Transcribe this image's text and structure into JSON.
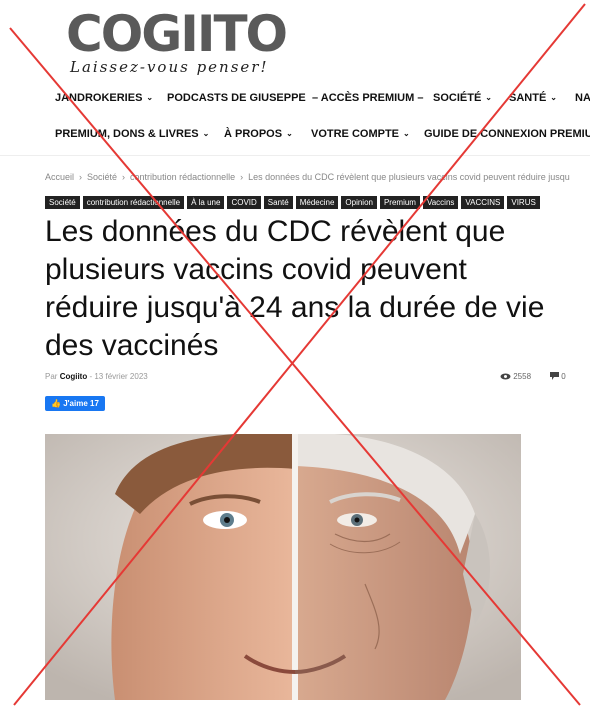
{
  "logo": {
    "text": "COGIITO",
    "tagline": "Laissez-vous penser!"
  },
  "nav": {
    "row1": [
      {
        "label": "JANDROKERIES",
        "chevron": true
      },
      {
        "label": "PODCASTS DE GIUSEPPE",
        "chevron": false
      },
      {
        "label": "– ACCÈS PREMIUM –",
        "chevron": false
      },
      {
        "label": "SOCIÉTÉ",
        "chevron": true
      },
      {
        "label": "SANTÉ",
        "chevron": true
      },
      {
        "label": "NA",
        "chevron": false
      }
    ],
    "row2": [
      {
        "label": "PREMIUM, DONS & LIVRES",
        "chevron": true
      },
      {
        "label": "À PROPOS",
        "chevron": true
      },
      {
        "label": "VOTRE COMPTE",
        "chevron": true
      },
      {
        "label": "GUIDE DE CONNEXION PREMIUM",
        "chevron": false
      }
    ]
  },
  "breadcrumb": [
    "Accueil",
    "Société",
    "contribution rédactionnelle",
    "Les données du CDC révèlent que plusieurs vaccins covid peuvent réduire jusqu"
  ],
  "tags": [
    "Société",
    "contribution rédactionnelle",
    "À la une",
    "COVID",
    "Santé",
    "Médecine",
    "Opinion",
    "Premium",
    "Vaccins",
    "VACCINS",
    "VIRUS"
  ],
  "article": {
    "title": "Les données du CDC révèlent que plusieurs vaccins covid peuvent réduire jusqu'à 24 ans la durée de vie des vaccinés",
    "by_label": "Par",
    "author": "Cogiito",
    "date": "13 février 2023",
    "views": "2558",
    "comments": "0",
    "like_label": "J'aime 17"
  },
  "icons": {
    "views": "eye-icon",
    "comments": "comment-icon",
    "like": "thumbs-up-icon"
  },
  "colors": {
    "cross": "#e53935",
    "like_button": "#1877f2",
    "tag_bg": "#222222"
  }
}
